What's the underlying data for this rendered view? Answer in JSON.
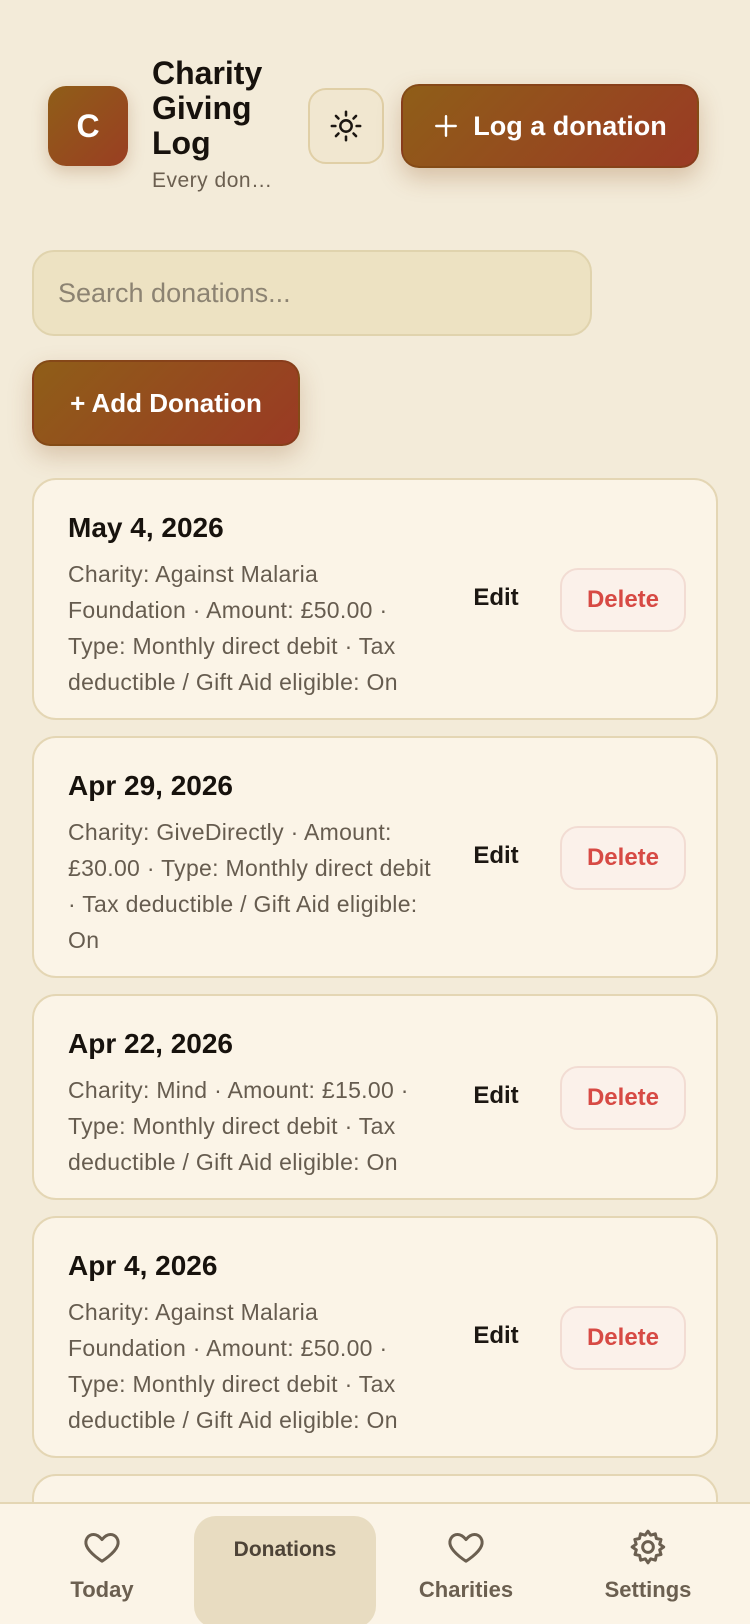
{
  "header": {
    "logo_letter": "C",
    "title": "Charity Giving Log",
    "subtitle": "Every donation",
    "log_button_label": "Log a donation",
    "theme_icon": "sun-icon"
  },
  "search": {
    "placeholder": "Search donations..."
  },
  "add_button_label": "+ Add Donation",
  "donations": [
    {
      "date": "May 4, 2026",
      "detail": "Charity: Against Malaria Foundation · Amount: £50.00 · Type: Monthly direct debit · Tax deductible / Gift Aid eligible: On",
      "edit_label": "Edit",
      "delete_label": "Delete"
    },
    {
      "date": "Apr 29, 2026",
      "detail": "Charity: GiveDirectly · Amount: £30.00 · Type: Monthly direct debit · Tax deductible / Gift Aid eligible: On",
      "edit_label": "Edit",
      "delete_label": "Delete"
    },
    {
      "date": "Apr 22, 2026",
      "detail": "Charity: Mind · Amount: £15.00 · Type: Monthly direct debit · Tax deductible / Gift Aid eligible: On",
      "edit_label": "Edit",
      "delete_label": "Delete"
    },
    {
      "date": "Apr 4, 2026",
      "detail": "Charity: Against Malaria Foundation · Amount: £50.00 · Type: Monthly direct debit · Tax deductible / Gift Aid eligible: On",
      "edit_label": "Edit",
      "delete_label": "Delete"
    }
  ],
  "nav": {
    "today": "Today",
    "donations": "Donations",
    "charities": "Charities",
    "settings": "Settings",
    "active": "donations"
  },
  "colors": {
    "background": "#f3ebd9",
    "accent_start": "#8f5e18",
    "accent_end": "#9a3a24",
    "delete_red": "#d74a44"
  }
}
